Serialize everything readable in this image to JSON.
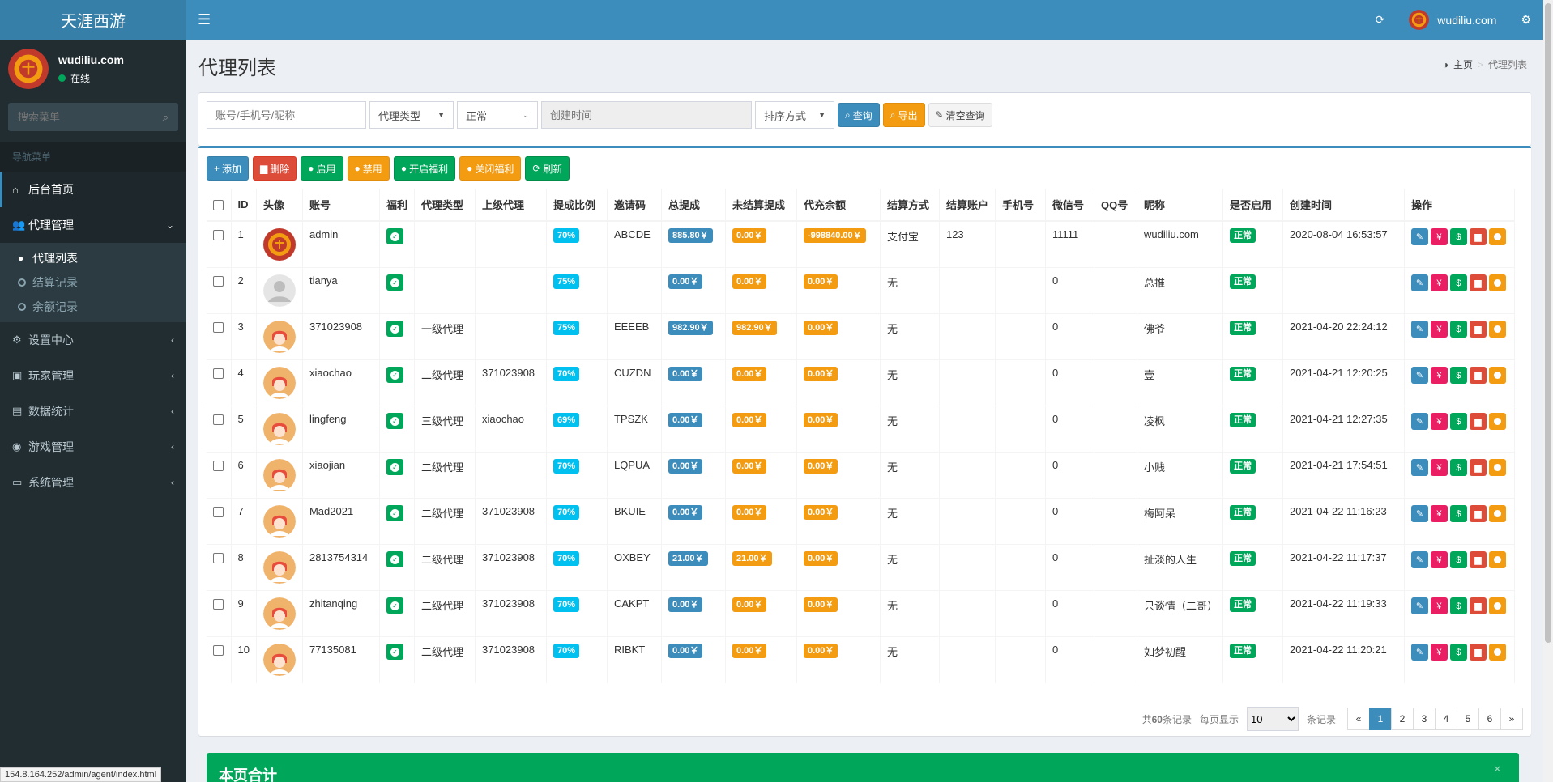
{
  "header": {
    "logo": "天涯西游",
    "toggle_icon": "☰",
    "refresh_icon": "⟳",
    "user": "wudiliu.com",
    "settings_icon": "⚙"
  },
  "sidebar": {
    "user_name": "wudiliu.com",
    "status": "在线",
    "search_placeholder": "搜索菜单",
    "nav_header": "导航菜单",
    "items": [
      {
        "icon": "⌂",
        "label": "后台首页"
      },
      {
        "icon": "👥",
        "label": "代理管理"
      },
      {
        "icon": "⚙",
        "label": "设置中心"
      },
      {
        "icon": "▣",
        "label": "玩家管理"
      },
      {
        "icon": "▤",
        "label": "数据统计"
      },
      {
        "icon": "◉",
        "label": "游戏管理"
      },
      {
        "icon": "▭",
        "label": "系统管理"
      }
    ],
    "sub_items": [
      "代理列表",
      "结算记录",
      "余额记录"
    ]
  },
  "page": {
    "title": "代理列表",
    "breadcrumb_home": "主页",
    "breadcrumb_current": "代理列表"
  },
  "filters": {
    "account_placeholder": "账号/手机号/昵称",
    "agent_type": "代理类型",
    "status": "正常",
    "created_placeholder": "创建时间",
    "sort": "排序方式",
    "search_btn": "查询",
    "export_btn": "导出",
    "clear_btn": "清空查询"
  },
  "toolbar": {
    "add": "添加",
    "delete": "删除",
    "enable": "启用",
    "disable": "禁用",
    "enable_welfare": "开启福利",
    "disable_welfare": "关闭福利",
    "refresh": "刷新"
  },
  "table": {
    "headers": [
      "ID",
      "头像",
      "账号",
      "福利",
      "代理类型",
      "上级代理",
      "提成比例",
      "邀请码",
      "总提成",
      "未结算提成",
      "代充余额",
      "结算方式",
      "结算账户",
      "手机号",
      "微信号",
      "QQ号",
      "昵称",
      "是否启用",
      "创建时间",
      "操作"
    ],
    "rows": [
      {
        "id": "1",
        "avatar": "logo",
        "account": "admin",
        "type": "",
        "parent": "",
        "rate": "70%",
        "code": "ABCDE",
        "total": "885.80￥",
        "unsettled": "0.00￥",
        "balance": "-998840.00￥",
        "method": "支付宝",
        "acct": "123",
        "phone": "",
        "wechat": "11111",
        "qq": "",
        "nick": "wudiliu.com",
        "enabled": "正常",
        "created": "2020-08-04 16:53:57"
      },
      {
        "id": "2",
        "avatar": "default",
        "account": "tianya",
        "type": "",
        "parent": "",
        "rate": "75%",
        "code": "",
        "total": "0.00￥",
        "unsettled": "0.00￥",
        "balance": "0.00￥",
        "method": "无",
        "acct": "",
        "phone": "",
        "wechat": "0",
        "qq": "",
        "nick": "总推",
        "enabled": "正常",
        "created": ""
      },
      {
        "id": "3",
        "avatar": "face",
        "account": "371023908",
        "type": "一级代理",
        "parent": "",
        "rate": "75%",
        "code": "EEEEB",
        "total": "982.90￥",
        "unsettled": "982.90￥",
        "balance": "0.00￥",
        "method": "无",
        "acct": "",
        "phone": "",
        "wechat": "0",
        "qq": "",
        "nick": "佛爷",
        "enabled": "正常",
        "created": "2021-04-20 22:24:12"
      },
      {
        "id": "4",
        "avatar": "face",
        "account": "xiaochao",
        "type": "二级代理",
        "parent": "371023908",
        "rate": "70%",
        "code": "CUZDN",
        "total": "0.00￥",
        "unsettled": "0.00￥",
        "balance": "0.00￥",
        "method": "无",
        "acct": "",
        "phone": "",
        "wechat": "0",
        "qq": "",
        "nick": "壹",
        "enabled": "正常",
        "created": "2021-04-21 12:20:25"
      },
      {
        "id": "5",
        "avatar": "face",
        "account": "lingfeng",
        "type": "三级代理",
        "parent": "xiaochao",
        "rate": "69%",
        "code": "TPSZK",
        "total": "0.00￥",
        "unsettled": "0.00￥",
        "balance": "0.00￥",
        "method": "无",
        "acct": "",
        "phone": "",
        "wechat": "0",
        "qq": "",
        "nick": "凌枫",
        "enabled": "正常",
        "created": "2021-04-21 12:27:35"
      },
      {
        "id": "6",
        "avatar": "face",
        "account": "xiaojian",
        "type": "二级代理",
        "parent": "",
        "rate": "70%",
        "code": "LQPUA",
        "total": "0.00￥",
        "unsettled": "0.00￥",
        "balance": "0.00￥",
        "method": "无",
        "acct": "",
        "phone": "",
        "wechat": "0",
        "qq": "",
        "nick": "小贱",
        "enabled": "正常",
        "created": "2021-04-21 17:54:51"
      },
      {
        "id": "7",
        "avatar": "face",
        "account": "Mad2021",
        "type": "二级代理",
        "parent": "371023908",
        "rate": "70%",
        "code": "BKUIE",
        "total": "0.00￥",
        "unsettled": "0.00￥",
        "balance": "0.00￥",
        "method": "无",
        "acct": "",
        "phone": "",
        "wechat": "0",
        "qq": "",
        "nick": "梅阿呆",
        "enabled": "正常",
        "created": "2021-04-22 11:16:23"
      },
      {
        "id": "8",
        "avatar": "face",
        "account": "2813754314",
        "type": "二级代理",
        "parent": "371023908",
        "rate": "70%",
        "code": "OXBEY",
        "total": "21.00￥",
        "unsettled": "21.00￥",
        "balance": "0.00￥",
        "method": "无",
        "acct": "",
        "phone": "",
        "wechat": "0",
        "qq": "",
        "nick": "扯淡的人生",
        "enabled": "正常",
        "created": "2021-04-22 11:17:37"
      },
      {
        "id": "9",
        "avatar": "face",
        "account": "zhitanqing",
        "type": "二级代理",
        "parent": "371023908",
        "rate": "70%",
        "code": "CAKPT",
        "total": "0.00￥",
        "unsettled": "0.00￥",
        "balance": "0.00￥",
        "method": "无",
        "acct": "",
        "phone": "",
        "wechat": "0",
        "qq": "",
        "nick": "只谈情（二哥）",
        "enabled": "正常",
        "created": "2021-04-22 11:19:33"
      },
      {
        "id": "10",
        "avatar": "face",
        "account": "77135081",
        "type": "二级代理",
        "parent": "371023908",
        "rate": "70%",
        "code": "RIBKT",
        "total": "0.00￥",
        "unsettled": "0.00￥",
        "balance": "0.00￥",
        "method": "无",
        "acct": "",
        "phone": "",
        "wechat": "0",
        "qq": "",
        "nick": "如梦初醒",
        "enabled": "正常",
        "created": "2021-04-22 11:20:21"
      }
    ]
  },
  "pagination": {
    "total_prefix": "共",
    "total": "60",
    "total_suffix": "条记录",
    "per_page_label": "每页显示",
    "per_page": "10",
    "records_label": "条记录",
    "prev": "«",
    "pages": [
      "1",
      "2",
      "3",
      "4",
      "5",
      "6"
    ],
    "next": "»",
    "current": "1"
  },
  "summary": {
    "title": "本页合计",
    "close": "×"
  },
  "status_url": "154.8.164.252/admin/agent/index.html",
  "colors": {
    "primary": "#3c8dbc",
    "sidebar": "#222d32",
    "success": "#00a65a",
    "warning": "#f39c12",
    "danger": "#dd4b39"
  }
}
